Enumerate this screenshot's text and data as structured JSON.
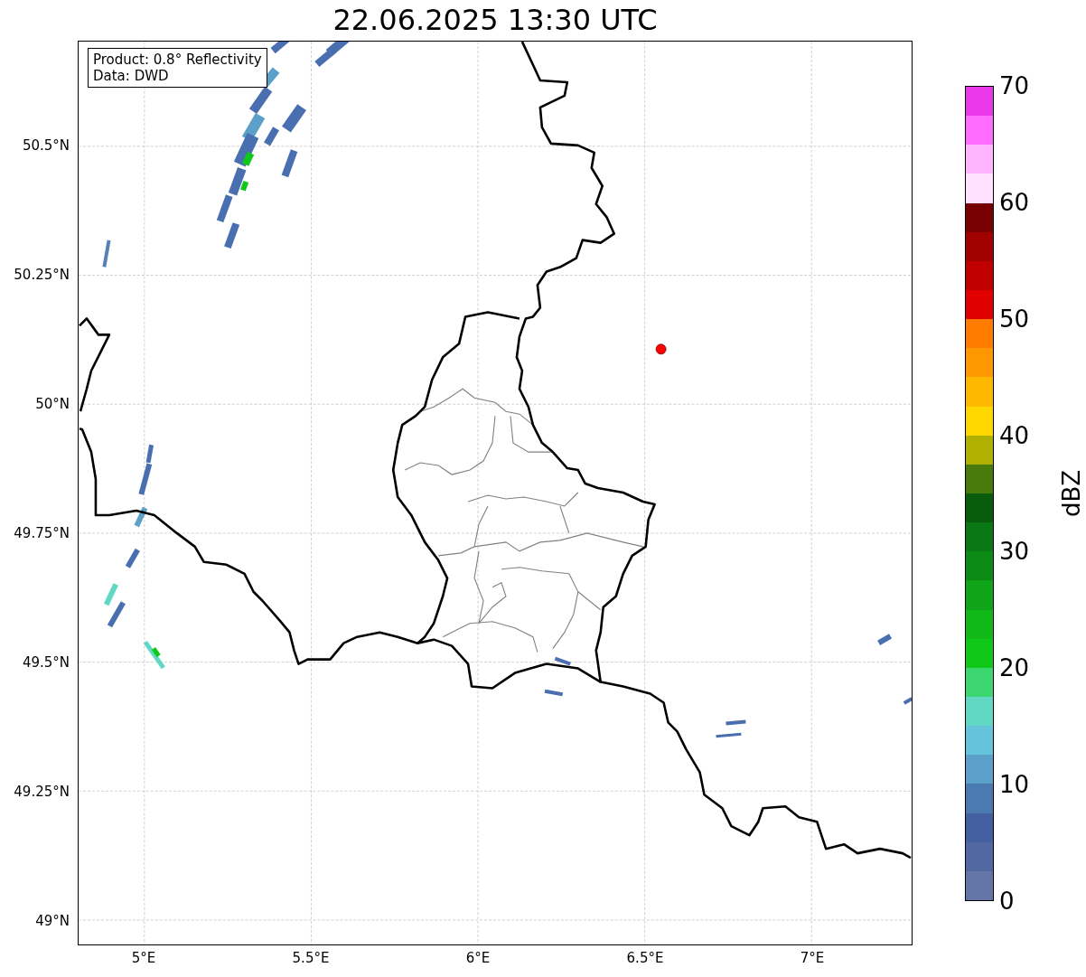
{
  "title": "22.06.2025 13:30 UTC",
  "legend": [
    "Product: 0.8° Reflectivity",
    "Data: DWD"
  ],
  "map": {
    "yticks": [
      "50.5°N",
      "50.25°N",
      "50°N",
      "49.75°N",
      "49.5°N",
      "49.25°N",
      "49°N"
    ],
    "xticks": [
      "5°E",
      "5.5°E",
      "6°E",
      "6.5°E",
      "7°E"
    ]
  },
  "colorbar": {
    "label": "dBZ",
    "ticks": [
      "70",
      "60",
      "50",
      "40",
      "30",
      "20",
      "10",
      "0"
    ],
    "segments": [
      {
        "color": "#e838e8"
      },
      {
        "color": "#ff6cff"
      },
      {
        "color": "#ffb4ff"
      },
      {
        "color": "#ffe0ff"
      },
      {
        "color": "#780000"
      },
      {
        "color": "#a00000"
      },
      {
        "color": "#c00000"
      },
      {
        "color": "#e00000"
      },
      {
        "color": "#ff7c00"
      },
      {
        "color": "#ff9800"
      },
      {
        "color": "#ffb800"
      },
      {
        "color": "#ffd800"
      },
      {
        "color": "#b0b000"
      },
      {
        "color": "#487a0c"
      },
      {
        "color": "#085c0c"
      },
      {
        "color": "#0a7814"
      },
      {
        "color": "#0c8c14"
      },
      {
        "color": "#10a418"
      },
      {
        "color": "#10b818"
      },
      {
        "color": "#10c818"
      },
      {
        "color": "#3cd670"
      },
      {
        "color": "#60d8c4"
      },
      {
        "color": "#66c3dc"
      },
      {
        "color": "#5aa0c8"
      },
      {
        "color": "#4a7ab0"
      },
      {
        "color": "#4560a0"
      },
      {
        "color": "#5268a0"
      },
      {
        "color": "#6475a8"
      }
    ]
  }
}
